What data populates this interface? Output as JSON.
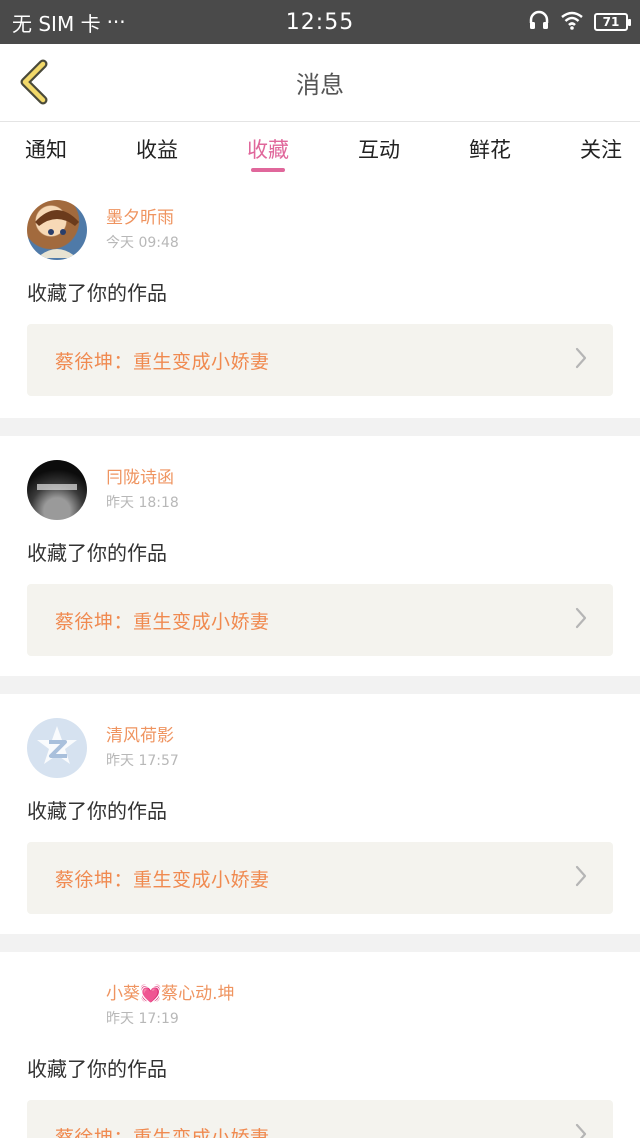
{
  "status_bar": {
    "carrier": "无 SIM 卡",
    "dots": "···",
    "time": "12:55",
    "battery": "71"
  },
  "header": {
    "title": "消息"
  },
  "tabs": [
    {
      "label": "通知",
      "active": false
    },
    {
      "label": "收益",
      "active": false
    },
    {
      "label": "收藏",
      "active": true
    },
    {
      "label": "互动",
      "active": false
    },
    {
      "label": "鲜花",
      "active": false
    },
    {
      "label": "关注",
      "active": false
    }
  ],
  "messages": [
    {
      "username": "墨夕昕雨",
      "time": "今天 09:48",
      "action": "收藏了你的作品",
      "work_title": "蔡徐坤：重生变成小娇妻",
      "avatar": "anime-girl-avatar"
    },
    {
      "username": "冃陇诗函",
      "time": "昨天 18:18",
      "action": "收藏了你的作品",
      "work_title": "蔡徐坤：重生变成小娇妻",
      "avatar": "dark-misty-avatar"
    },
    {
      "username": "清风荷影",
      "time": "昨天 17:57",
      "action": "收藏了你的作品",
      "work_title": "蔡徐坤：重生变成小娇妻",
      "avatar": "default-z-avatar"
    },
    {
      "username": "小葵💓蔡心动.坤",
      "time": "昨天 17:19",
      "action": "收藏了你的作品",
      "work_title": "蔡徐坤：重生变成小娇妻",
      "avatar": "blank-avatar"
    }
  ],
  "colors": {
    "accent_pink": "#e0679b",
    "username_orange": "#ef9460",
    "work_title_orange": "#f08a50",
    "link_bg": "#f4f3ee"
  }
}
